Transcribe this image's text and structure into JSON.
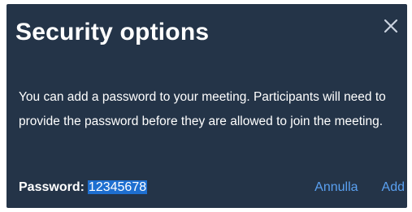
{
  "dialog": {
    "title": "Security options",
    "message": "You can add a password to your meeting. Participants will need to provide the password before they are allowed to join the meeting.",
    "password_label": "Password:",
    "password_value": "12345678",
    "cancel_label": "Annulla",
    "add_label": "Add",
    "close_icon": "close-icon"
  },
  "colors": {
    "background": "#243448",
    "text": "#ffffff",
    "link": "#5aa0f0",
    "selection": "#1e6fd0"
  }
}
